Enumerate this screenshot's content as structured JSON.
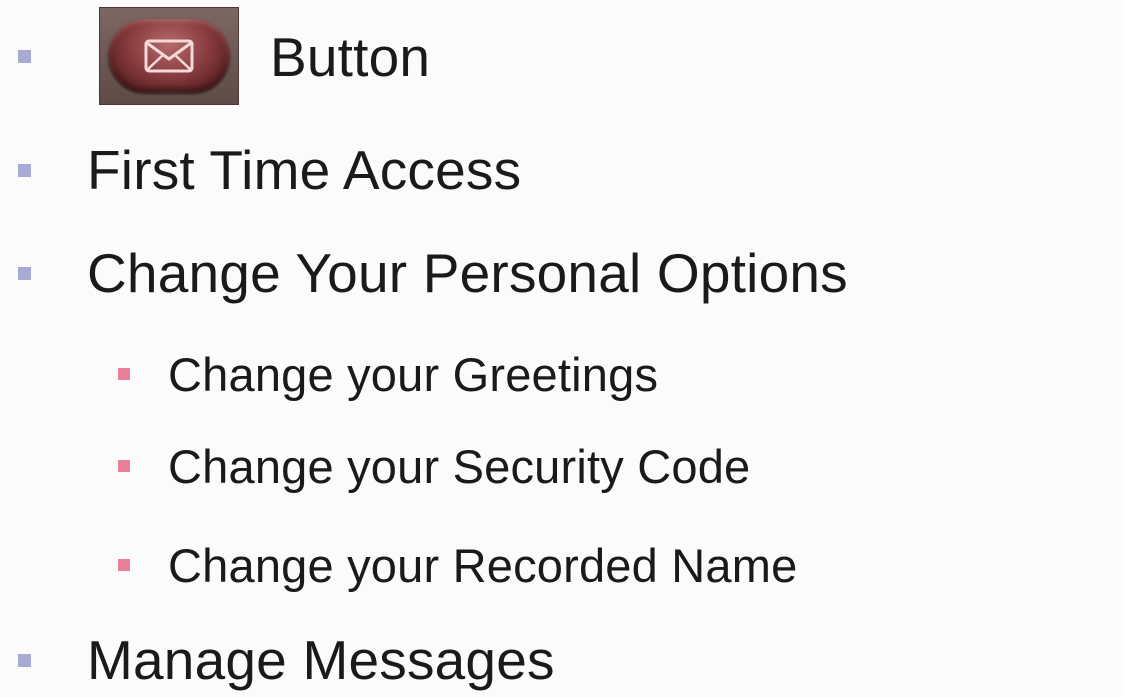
{
  "items": [
    {
      "level": 1,
      "text": "Button",
      "has_icon": true,
      "icon": "envelope-icon"
    },
    {
      "level": 1,
      "text": "First Time Access"
    },
    {
      "level": 1,
      "text": "Change Your Personal Options"
    },
    {
      "level": 2,
      "text": "Change your Greetings"
    },
    {
      "level": 2,
      "text": "Change your Security Code"
    },
    {
      "level": 2,
      "text": "Change your Recorded Name"
    },
    {
      "level": 1,
      "text": "Manage Messages"
    }
  ],
  "colors": {
    "bullet_level1": "#a9aad4",
    "bullet_level2": "#ea7e98",
    "background": "#fbfbfb",
    "text": "#1a1a1a"
  }
}
